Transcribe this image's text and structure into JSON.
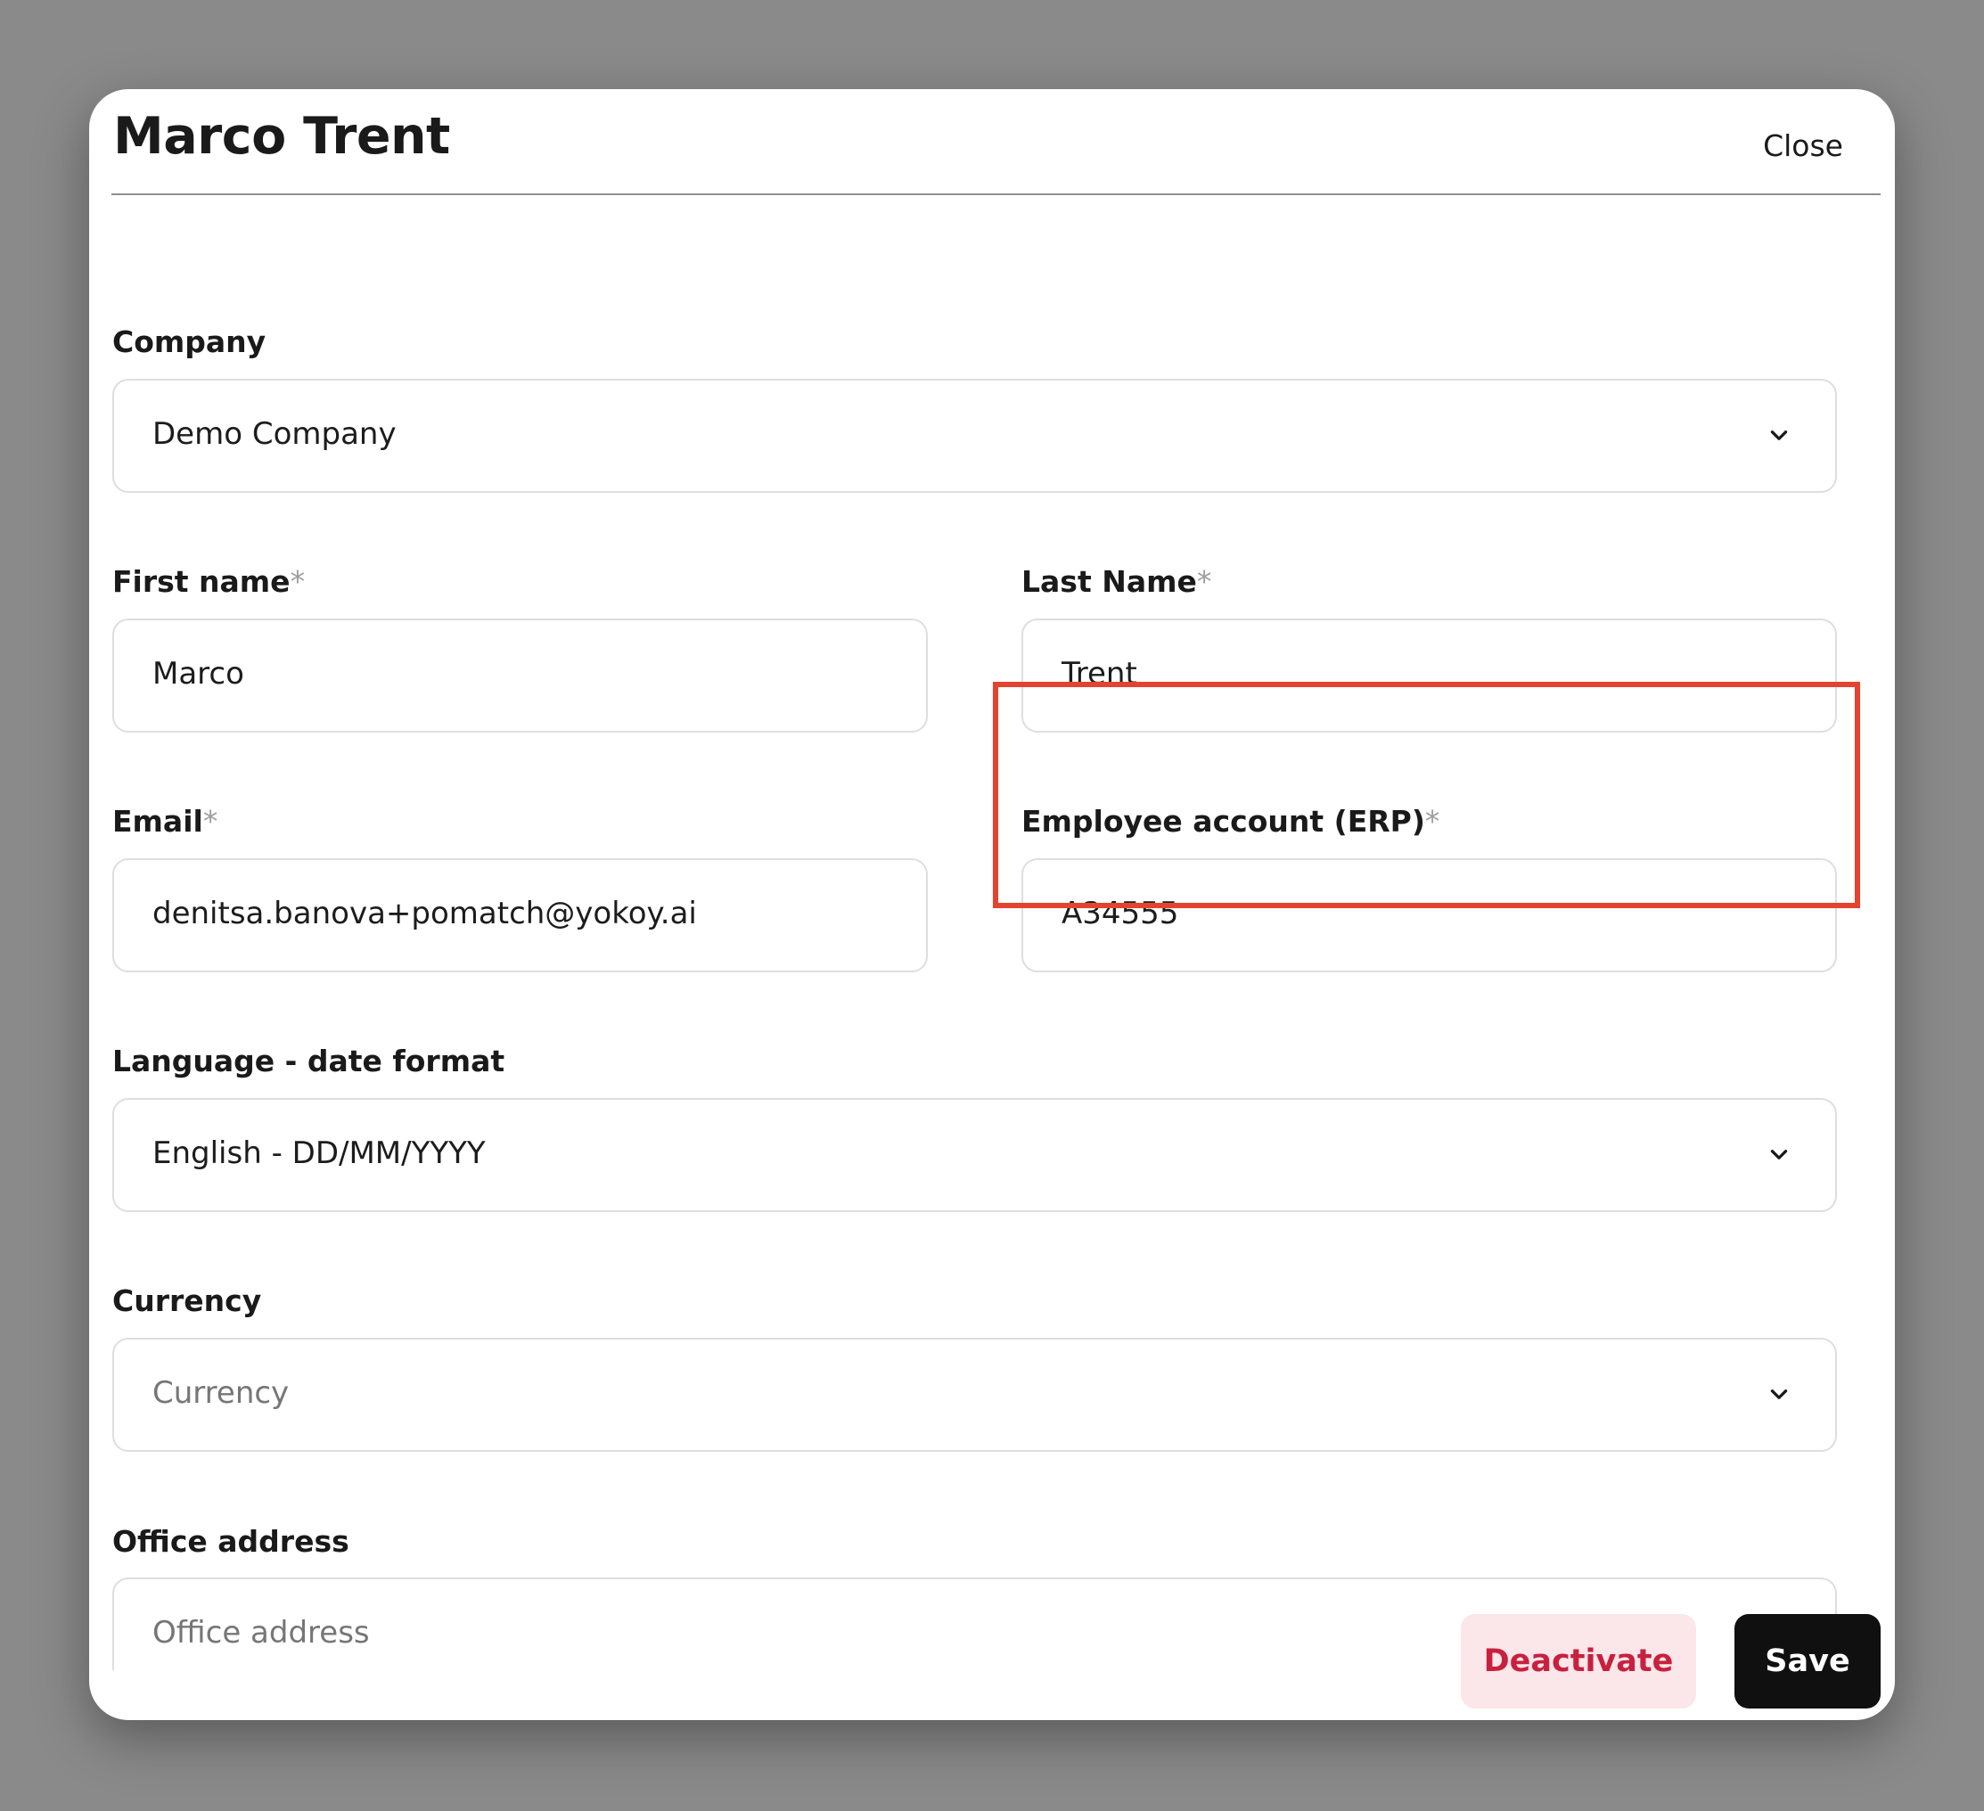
{
  "modal": {
    "title": "Marco Trent",
    "close_label": "Close"
  },
  "form": {
    "company": {
      "label": "Company",
      "value": "Demo Company",
      "icon": "chevron-down-icon"
    },
    "first_name": {
      "label": "First name",
      "required_mark": "*",
      "value": "Marco"
    },
    "last_name": {
      "label": "Last Name",
      "required_mark": "*",
      "value": "Trent"
    },
    "email": {
      "label": "Email",
      "required_mark": "*",
      "value": "denitsa.banova+pomatch@yokoy.ai"
    },
    "employee_account": {
      "label": "Employee account (ERP)",
      "required_mark": "*",
      "value": "A34555"
    },
    "language": {
      "label": "Language - date format",
      "value": "English - DD/MM/YYYY",
      "icon": "chevron-down-icon"
    },
    "currency": {
      "label": "Currency",
      "placeholder": "Currency",
      "icon": "chevron-down-icon"
    },
    "office_address": {
      "label": "Office address",
      "placeholder": "Office address",
      "icon": "chevron-down-icon"
    }
  },
  "footer": {
    "deactivate_label": "Deactivate",
    "save_label": "Save"
  },
  "colors": {
    "highlight": "#e4432f",
    "deactivate_text": "#c8203f",
    "deactivate_bg": "#fbe6e9",
    "save_bg": "#101010"
  }
}
